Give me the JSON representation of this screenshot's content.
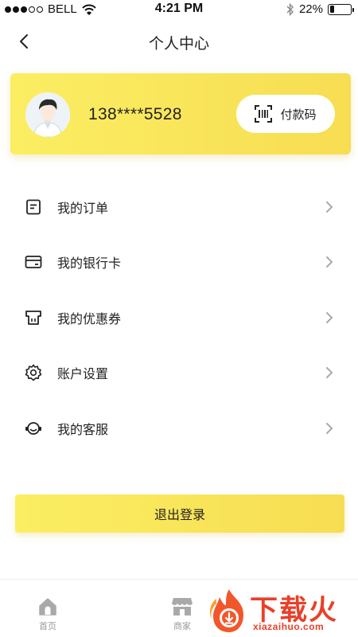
{
  "status_bar": {
    "carrier": "BELL",
    "time": "4:21 PM",
    "battery_percent": "22%",
    "battery_level": 0.22,
    "signal_bars_filled": 3,
    "signal_bars_total": 5,
    "icons": [
      "signal-dots-icon",
      "wifi-icon",
      "bluetooth-icon",
      "battery-icon"
    ]
  },
  "nav": {
    "title": "个人中心",
    "back_icon": "chevron-left-icon"
  },
  "profile": {
    "phone": "138****5528",
    "avatar_icon": "user-avatar-icon",
    "pay_code": {
      "label": "付款码",
      "icon": "barcode-scan-icon"
    }
  },
  "menu": {
    "items": [
      {
        "label": "我的订单",
        "icon": "order-document-icon"
      },
      {
        "label": "我的银行卡",
        "icon": "bank-card-icon"
      },
      {
        "label": "我的优惠券",
        "icon": "coupon-icon"
      },
      {
        "label": "账户设置",
        "icon": "gear-icon"
      },
      {
        "label": "我的客服",
        "icon": "customer-service-icon"
      }
    ],
    "chevron_icon": "chevron-right-icon"
  },
  "logout": {
    "label": "退出登录"
  },
  "tabbar": {
    "tabs": [
      {
        "label": "首页",
        "icon": "home-icon"
      },
      {
        "label": "商家",
        "icon": "store-icon"
      }
    ]
  },
  "watermark": {
    "text": "下载火",
    "url": "xiazaihuo.com",
    "icon": "flame-logo-icon"
  },
  "colors": {
    "accent_yellow": "#f9e55a",
    "text_primary": "#222222",
    "text_secondary": "#999999",
    "watermark_red": "#e8402a"
  }
}
